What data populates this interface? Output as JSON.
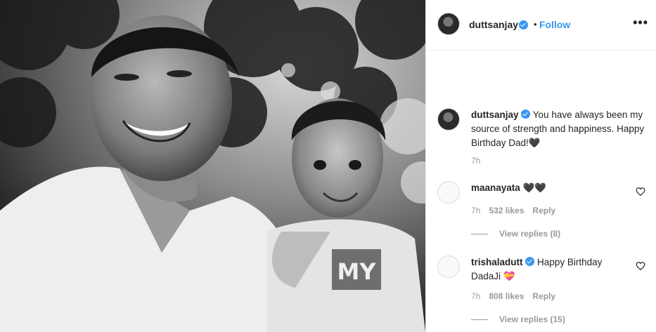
{
  "post": {
    "username": "duttsanjay",
    "verified": true,
    "separator": "•",
    "follow_label": "Follow",
    "more_label": "•••",
    "photo_text": "MY",
    "caption": {
      "username": "duttsanjay",
      "text": "You have always been my source of strength and happiness. Happy Birthday Dad!🖤",
      "time": "7h"
    }
  },
  "comments": [
    {
      "username": "maanayata",
      "verified": false,
      "text": "🖤🖤",
      "time": "7h",
      "likes": "532 likes",
      "reply_label": "Reply",
      "view_replies": "View replies (8)"
    },
    {
      "username": "trishaladutt",
      "verified": true,
      "text": "Happy Birthday DadaJi 💝",
      "time": "7h",
      "likes": "808 likes",
      "reply_label": "Reply",
      "view_replies": "View replies (15)"
    }
  ],
  "colors": {
    "accent": "#3897f0",
    "text": "#262626",
    "muted": "#999999",
    "border": "#efefef"
  },
  "icons": {
    "verified": "verified-badge-icon",
    "more": "more-options-icon",
    "like": "heart-outline-icon"
  }
}
